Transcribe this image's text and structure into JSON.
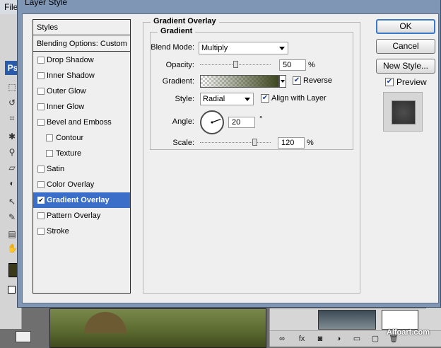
{
  "app": {
    "menu_file": "File"
  },
  "dialog": {
    "title": "Layer Style"
  },
  "styles_list": {
    "header": "Styles",
    "blending_options": "Blending Options: Custom",
    "items": [
      {
        "label": "Drop Shadow",
        "checked": false
      },
      {
        "label": "Inner Shadow",
        "checked": false
      },
      {
        "label": "Outer Glow",
        "checked": false
      },
      {
        "label": "Inner Glow",
        "checked": false
      },
      {
        "label": "Bevel and Emboss",
        "checked": false
      },
      {
        "label": "Contour",
        "checked": false
      },
      {
        "label": "Texture",
        "checked": false
      },
      {
        "label": "Satin",
        "checked": false
      },
      {
        "label": "Color Overlay",
        "checked": false
      },
      {
        "label": "Gradient Overlay",
        "checked": true
      },
      {
        "label": "Pattern Overlay",
        "checked": false
      },
      {
        "label": "Stroke",
        "checked": false
      }
    ]
  },
  "gradient_overlay": {
    "group_title": "Gradient Overlay",
    "subgroup_title": "Gradient",
    "blend_mode_label": "Blend Mode:",
    "blend_mode_value": "Multiply",
    "opacity_label": "Opacity:",
    "opacity_value": "50",
    "opacity_unit": "%",
    "opacity_fraction": 0.5,
    "gradient_label": "Gradient:",
    "reverse_label": "Reverse",
    "reverse_checked": true,
    "style_label": "Style:",
    "style_value": "Radial",
    "align_label": "Align with Layer",
    "align_checked": true,
    "angle_label": "Angle:",
    "angle_value": "20",
    "angle_unit": "°",
    "scale_label": "Scale:",
    "scale_value": "120",
    "scale_unit": "%",
    "scale_fraction": 0.8
  },
  "buttons": {
    "ok": "OK",
    "cancel": "Cancel",
    "new_style": "New Style...",
    "preview_label": "Preview",
    "preview_checked": true
  },
  "watermark": "Alfoart.com",
  "colors": {
    "selection": "#3a6ec8",
    "dialog_frame": "#7f97b5",
    "gradient_end": "#3c461e"
  }
}
